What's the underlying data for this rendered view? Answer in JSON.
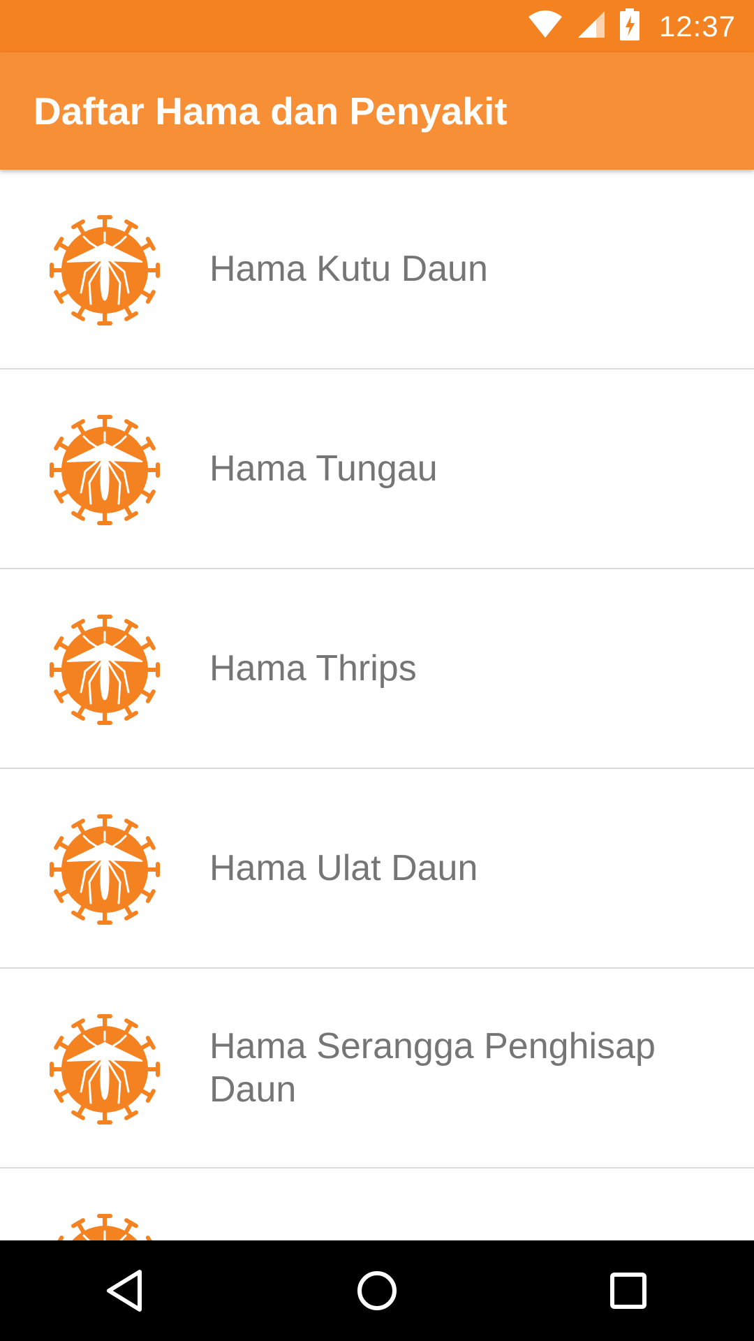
{
  "status_bar": {
    "time": "12:37",
    "icons": [
      "wifi-icon",
      "signal-icon",
      "battery-charging-icon"
    ]
  },
  "app_bar": {
    "title": "Daftar Hama dan Penyakit",
    "color": "#f78f36"
  },
  "list": {
    "icon": "mosquito-virus-icon",
    "icon_color": "#f58220",
    "items": [
      {
        "label": "Hama Kutu Daun"
      },
      {
        "label": "Hama Tungau"
      },
      {
        "label": "Hama Thrips"
      },
      {
        "label": "Hama Ulat Daun"
      },
      {
        "label": "Hama Serangga Penghisap Daun"
      },
      {
        "label": ""
      }
    ]
  },
  "nav_bar": {
    "buttons": [
      "back-icon",
      "home-icon",
      "recents-icon"
    ]
  }
}
